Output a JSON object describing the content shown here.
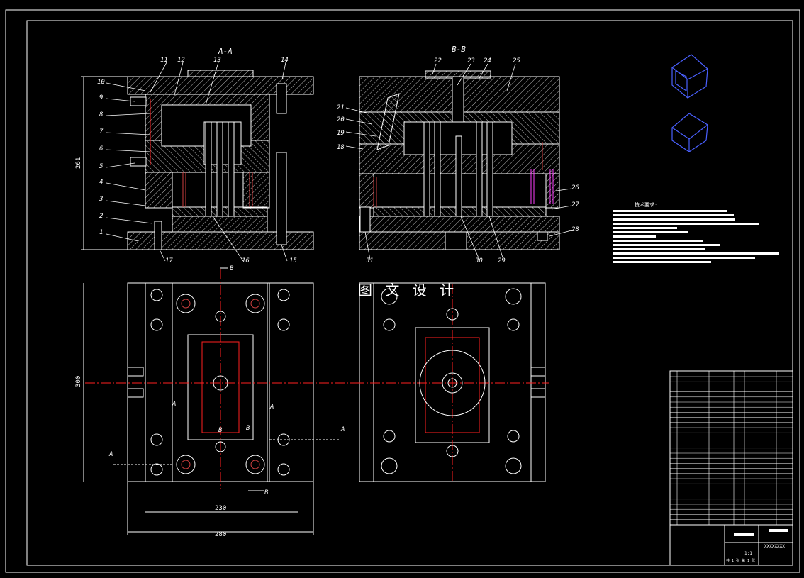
{
  "drawing": {
    "section_aa": "A-A",
    "section_bb": "B-B",
    "dim_left_height": "261",
    "dim_plan_height": "300",
    "dim_width_inner": "230",
    "dim_width_outer": "280",
    "tech_heading": "技术要求:",
    "watermark": "图 文 设 计",
    "marks": [
      "A",
      "A",
      "A",
      "A",
      "B",
      "B",
      "B",
      "B"
    ],
    "part_numbers_left": [
      "1",
      "2",
      "3",
      "4",
      "5",
      "6",
      "7",
      "8",
      "9",
      "10",
      "11",
      "12",
      "13",
      "14",
      "15",
      "16",
      "17"
    ],
    "part_numbers_right": [
      "18",
      "19",
      "20",
      "21",
      "22",
      "23",
      "24",
      "25",
      "26",
      "27",
      "28",
      "29",
      "30",
      "31"
    ],
    "scale": "1:1",
    "sheet_text": "共 1 张  第 1 张",
    "drawing_no": "XXXXXXXX"
  },
  "colors": {
    "background": "#000000",
    "outline": "#ffffff",
    "hatch": "#c8c8c8",
    "centerline": "#ff2020",
    "hidden": "#d04040",
    "magenta": "#ff40ff",
    "iso_view": "#4a60ff"
  }
}
